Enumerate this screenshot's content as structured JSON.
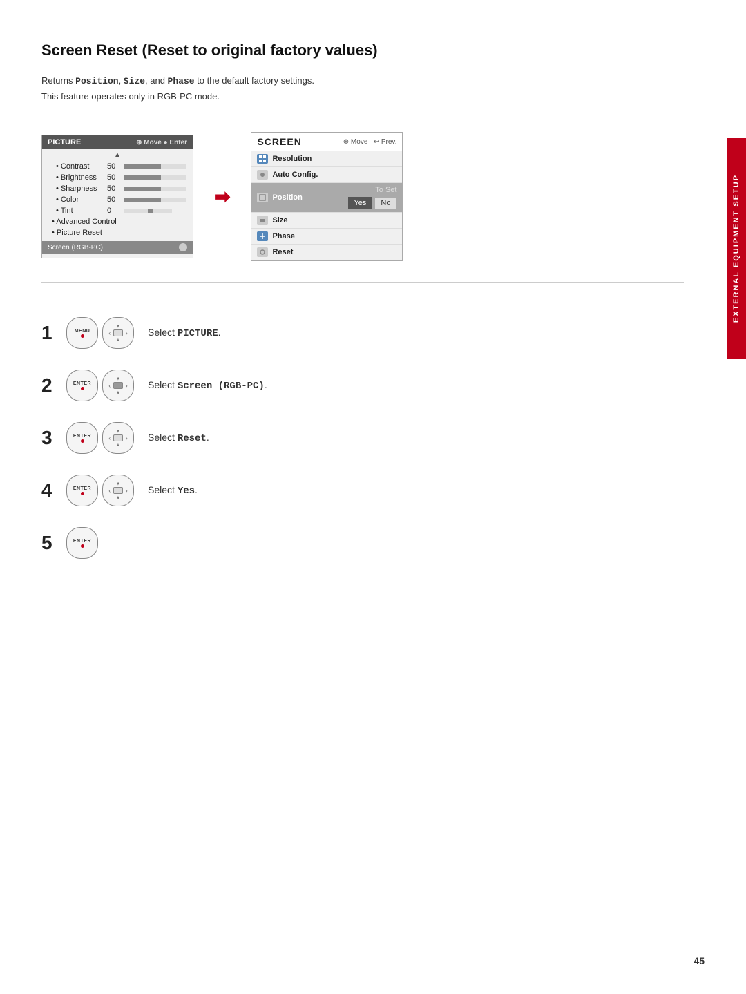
{
  "page": {
    "title": "Screen Reset (Reset to original factory values)",
    "description_line1": "Returns ",
    "description_bold1": "Position",
    "description_mid1": ", ",
    "description_bold2": "Size",
    "description_mid2": ", and ",
    "description_bold3": "Phase",
    "description_end": " to the default factory settings.",
    "description_line2": "This feature operates only in RGB-PC mode.",
    "side_tab": "EXTERNAL EQUIPMENT SETUP",
    "page_number": "45"
  },
  "picture_menu": {
    "header": "PICTURE",
    "nav": "Move  Enter",
    "items": [
      {
        "label": "Contrast",
        "value": "50",
        "bar": 60
      },
      {
        "label": "Brightness",
        "value": "50",
        "bar": 60
      },
      {
        "label": "Sharpness",
        "value": "50",
        "bar": 60
      },
      {
        "label": "Color",
        "value": "50",
        "bar": 60
      },
      {
        "label": "Tint",
        "value": "0",
        "type": "tint"
      }
    ],
    "bullets": [
      "Advanced Control",
      "Picture Reset"
    ],
    "footer": "Screen (RGB-PC)"
  },
  "screen_menu": {
    "header": "SCREEN",
    "nav_move": "Move",
    "nav_prev": "Prev.",
    "items": [
      {
        "label": "Resolution",
        "icon": "grid"
      },
      {
        "label": "Auto Config.",
        "icon": "circle"
      },
      {
        "label": "Position",
        "icon": "square",
        "active": true
      },
      {
        "label": "Size",
        "icon": "bar"
      },
      {
        "label": "Phase",
        "icon": "plus"
      },
      {
        "label": "Reset",
        "icon": "circle-o"
      }
    ],
    "to_set_label": "To Set",
    "yes_label": "Yes",
    "no_label": "No"
  },
  "steps": [
    {
      "number": "1",
      "button1": "MENU",
      "text_prefix": "Select ",
      "text_bold": "PICTURE",
      "text_suffix": "."
    },
    {
      "number": "2",
      "button1": "ENTER",
      "text_prefix": "Select ",
      "text_bold": "Screen (RGB-PC)",
      "text_suffix": "."
    },
    {
      "number": "3",
      "button1": "ENTER",
      "text_prefix": "Select ",
      "text_bold": "Reset",
      "text_suffix": "."
    },
    {
      "number": "4",
      "button1": "ENTER",
      "text_prefix": "Select ",
      "text_bold": "Yes",
      "text_suffix": "."
    },
    {
      "number": "5",
      "button1": "ENTER",
      "text_prefix": "",
      "text_bold": "",
      "text_suffix": ""
    }
  ]
}
